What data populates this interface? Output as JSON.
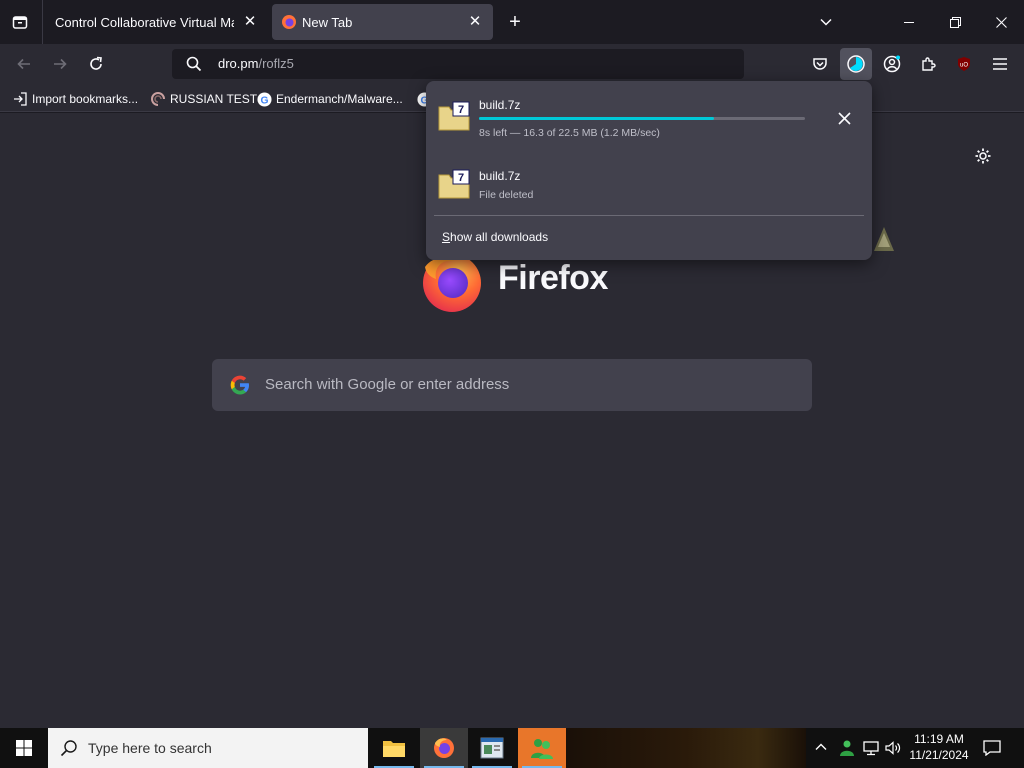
{
  "tabs": [
    {
      "label": "Control Collaborative Virtual Machin",
      "active": false
    },
    {
      "label": "New Tab",
      "active": true
    }
  ],
  "urlbar": {
    "domain": "dro.pm",
    "path": "/roflz5"
  },
  "bookmarks": [
    {
      "label": "Import bookmarks...",
      "icon": "import-icon"
    },
    {
      "label": "RUSSIAN TEST",
      "icon": "spiral-icon"
    },
    {
      "label": "Endermanch/Malware...",
      "icon": "google-icon"
    }
  ],
  "downloads": {
    "items": [
      {
        "name": "build.7z",
        "status": "8s left — 16.3 of 22.5 MB (1.2 MB/sec)",
        "progress": 0.72
      },
      {
        "name": "build.7z",
        "status": "File deleted"
      }
    ],
    "show_all": "Show all downloads",
    "show_all_mnemonic": "S",
    "show_all_rest": "how all downloads"
  },
  "newtab": {
    "brand": "Firefox",
    "search_placeholder": "Search with Google or enter address"
  },
  "taskbar": {
    "search_placeholder": "Type here to search",
    "time": "11:19 AM",
    "date": "11/21/2024"
  },
  "colors": {
    "accent": "#00ddff",
    "progress": "#00c8d7",
    "panel_bg": "#42414d",
    "content_bg": "#2b2a33"
  }
}
